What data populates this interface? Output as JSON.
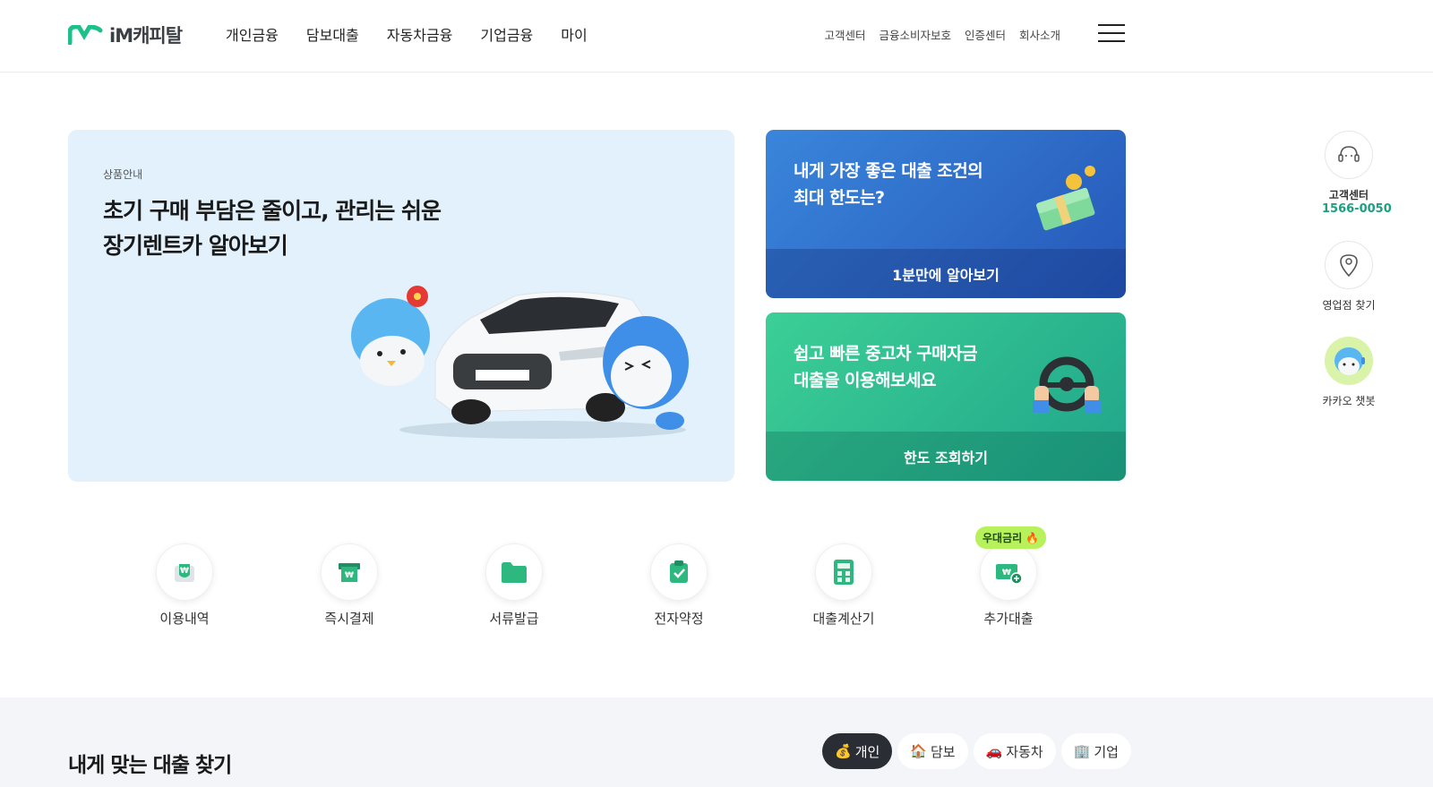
{
  "brand": {
    "name": "iM캐피탈",
    "accent": "#1dbf8a"
  },
  "gnb": [
    "개인금융",
    "담보대출",
    "자동차금융",
    "기업금융",
    "마이"
  ],
  "util": [
    "고객센터",
    "금융소비자보호",
    "인증센터",
    "회사소개"
  ],
  "hero": {
    "kicker": "상품안내",
    "title_line1": "초기 구매 부담은 줄이고, 관리는 쉬운",
    "title_line2": "장기렌트카 알아보기"
  },
  "promos": [
    {
      "line1": "내게 가장 좋은 대출 조건의",
      "line2": "최대 한도는?",
      "cta": "1분만에 알아보기",
      "icon": "money-stack-icon"
    },
    {
      "line1": "쉽고 빠른 중고차 구매자금",
      "line2": "대출을 이용해보세요",
      "cta": "한도 조회하기",
      "icon": "steering-wheel-icon"
    }
  ],
  "quick_menu": [
    {
      "label": "이용내역",
      "icon": "usage-history-icon"
    },
    {
      "label": "즉시결제",
      "icon": "instant-payment-icon"
    },
    {
      "label": "서류발급",
      "icon": "document-folder-icon"
    },
    {
      "label": "전자약정",
      "icon": "e-contract-icon"
    },
    {
      "label": "대출계산기",
      "icon": "calculator-icon"
    },
    {
      "label": "추가대출",
      "icon": "additional-loan-icon",
      "badge": "우대금리"
    }
  ],
  "side": {
    "cs_label": "고객센터",
    "cs_phone": "1566-0050",
    "branch": "영업점 찾기",
    "chatbot": "카카오 챗봇"
  },
  "section": {
    "title": "내게 맞는 대출 찾기"
  },
  "tabs": [
    {
      "label": "개인",
      "active": true
    },
    {
      "label": "담보",
      "active": false
    },
    {
      "label": "자동차",
      "active": false
    },
    {
      "label": "기업",
      "active": false
    }
  ]
}
